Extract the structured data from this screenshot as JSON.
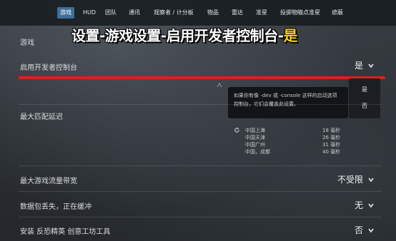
{
  "nav": {
    "tabs": [
      {
        "label": "游戏",
        "active": true
      },
      {
        "label": "HUD"
      },
      {
        "label": "团队"
      },
      {
        "label": "通讯"
      },
      {
        "label": "观察者 / 计分板"
      },
      {
        "label": "物品"
      },
      {
        "label": "雷达"
      },
      {
        "label": "准星"
      },
      {
        "label": "投掷物瞄点准星"
      },
      {
        "label": "遮蔽"
      }
    ]
  },
  "headline": {
    "prefix": "设置-游戏设置-启用开发者控制台-",
    "highlight": "是"
  },
  "section": {
    "title": "游戏"
  },
  "settings": [
    {
      "label": "启用开发者控制台",
      "value": "是"
    },
    {
      "label": "最大匹配延迟",
      "value": ""
    },
    {
      "label": "最大游戏流量带宽",
      "value": "不受限"
    },
    {
      "label": "数据包丢失，正在缓冲",
      "value": "无"
    },
    {
      "label": "安装 反恐精英 创意工坊工具",
      "value": "否"
    }
  ],
  "tooltip": {
    "line1": "如果你有像 -dev 或 -console 这样的启动选项",
    "line2": "控制台，它们会覆盖此设置。"
  },
  "dropdown": {
    "options": [
      "是",
      "否"
    ],
    "partial_text": "用"
  },
  "servers": [
    {
      "name": "中国上海",
      "ping": "18 毫秒"
    },
    {
      "name": "中国天津",
      "ping": "26 毫秒"
    },
    {
      "name": "中国广州",
      "ping": "31 毫秒"
    },
    {
      "name": "中国，成都",
      "ping": "40 毫秒"
    }
  ],
  "colors": {
    "accent_tab": "#3d6e99",
    "highlight": "#f5d321",
    "red_line": "#e01e1e"
  },
  "icons": {
    "refresh": "refresh-icon",
    "chevron": "chevron-down-icon"
  }
}
